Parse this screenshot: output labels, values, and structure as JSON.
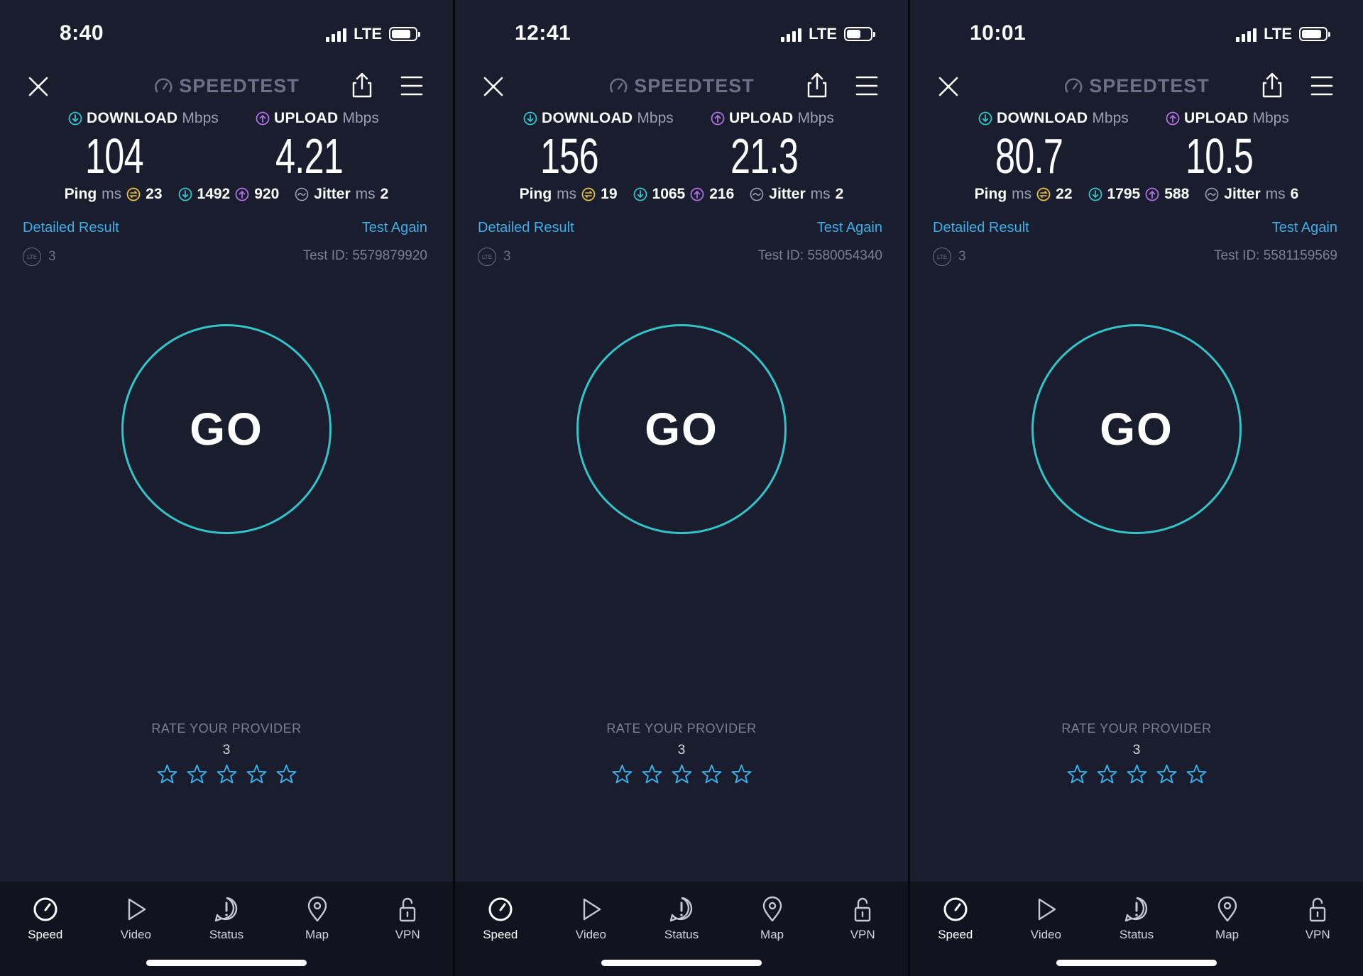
{
  "colors": {
    "background": "#1a1d2e",
    "accent_teal": "#31c4c9",
    "link_blue": "#3ab0e8",
    "upload_purple": "#b06fe0",
    "ping_yellow": "#e8c13a",
    "muted": "#7a7f96"
  },
  "common": {
    "brand": "SPEEDTEST",
    "download_label": "DOWNLOAD",
    "upload_label": "UPLOAD",
    "unit_mbps": "Mbps",
    "ping_label": "Ping",
    "unit_ms": "ms",
    "jitter_label": "Jitter",
    "detailed_result": "Detailed Result",
    "test_again": "Test Again",
    "lte_badge": "LTE",
    "network_value": "3",
    "lte": "LTE",
    "go": "GO",
    "rate_title": "RATE YOUR PROVIDER",
    "rate_value": "3",
    "tabs": [
      "Speed",
      "Video",
      "Status",
      "Map",
      "VPN"
    ]
  },
  "screens": [
    {
      "time": "8:40",
      "download": "104",
      "upload": "4.21",
      "ping": "23",
      "ping_down": "1492",
      "ping_up": "920",
      "jitter": "2",
      "test_id": "Test ID: 5579879920"
    },
    {
      "time": "12:41",
      "download": "156",
      "upload": "21.3",
      "ping": "19",
      "ping_down": "1065",
      "ping_up": "216",
      "jitter": "2",
      "test_id": "Test ID: 5580054340"
    },
    {
      "time": "10:01",
      "download": "80.7",
      "upload": "10.5",
      "ping": "22",
      "ping_down": "1795",
      "ping_up": "588",
      "jitter": "6",
      "test_id": "Test ID: 5581159569"
    }
  ]
}
